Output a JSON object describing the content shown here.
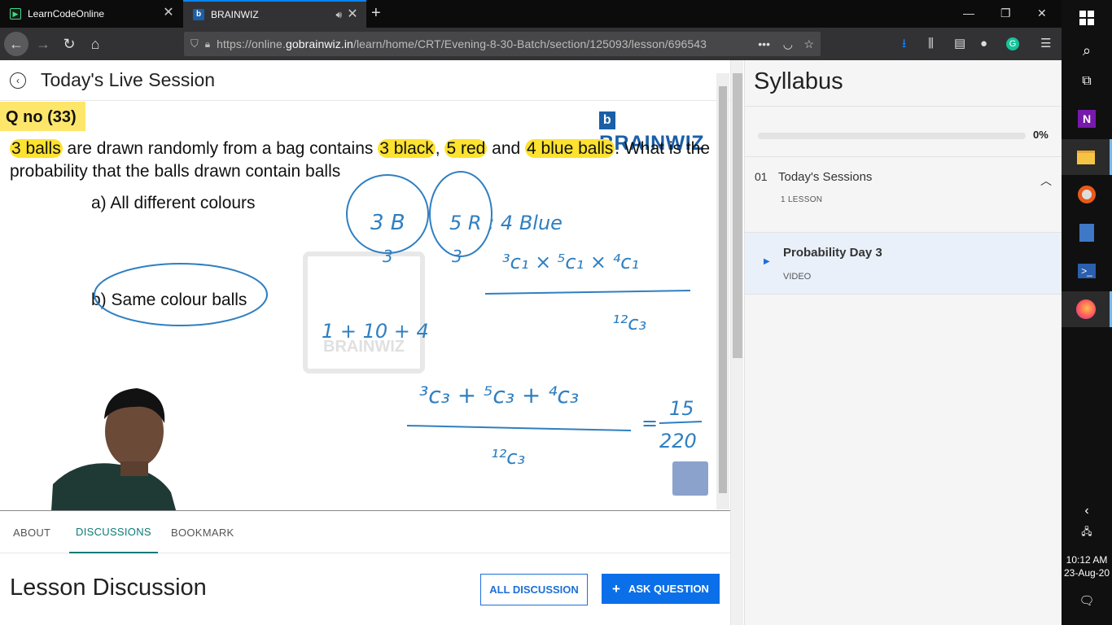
{
  "browser": {
    "tabs": [
      {
        "title": "LearnCodeOnline"
      },
      {
        "title": "BRAINWIZ"
      }
    ],
    "url_prefix": "https://online.",
    "url_domain": "gobrainwiz.in",
    "url_path": "/learn/home/CRT/Evening-8-30-Batch/section/125093/lesson/696543",
    "url_more": "•••"
  },
  "page": {
    "title": "Today's Live Session"
  },
  "video": {
    "question_no": "Q no (33)",
    "logo_text": "BRAINWIZ",
    "question_parts": [
      "3 balls",
      " are drawn randomly from a bag contains ",
      "3 black",
      ", ",
      "5 red",
      " and ",
      "4 blue balls",
      ". What is the probability that the balls drawn contain balls"
    ],
    "option_a": "a) All different colours",
    "option_b": "b) Same colour balls",
    "watermark": "BRAINWIZ"
  },
  "tabs": [
    "ABOUT",
    "DISCUSSIONS",
    "BOOKMARK"
  ],
  "discussion": {
    "heading": "Lesson Discussion",
    "all_button": "ALL DISCUSSION",
    "ask_button": "ASK QUESTION"
  },
  "syllabus": {
    "heading": "Syllabus",
    "progress_percent": 0,
    "progress_label": "0%",
    "section": {
      "number": "01",
      "title": "Today's Sessions",
      "count": "1 LESSON"
    },
    "lesson": {
      "title": "Probability Day 3",
      "type": "VIDEO"
    }
  },
  "system": {
    "time": "10:12 AM",
    "date": "23-Aug-20"
  },
  "colors": {
    "accent_teal": "#0b7a76",
    "primary_blue": "#0a6fe8",
    "highlight": "#fde22f"
  }
}
